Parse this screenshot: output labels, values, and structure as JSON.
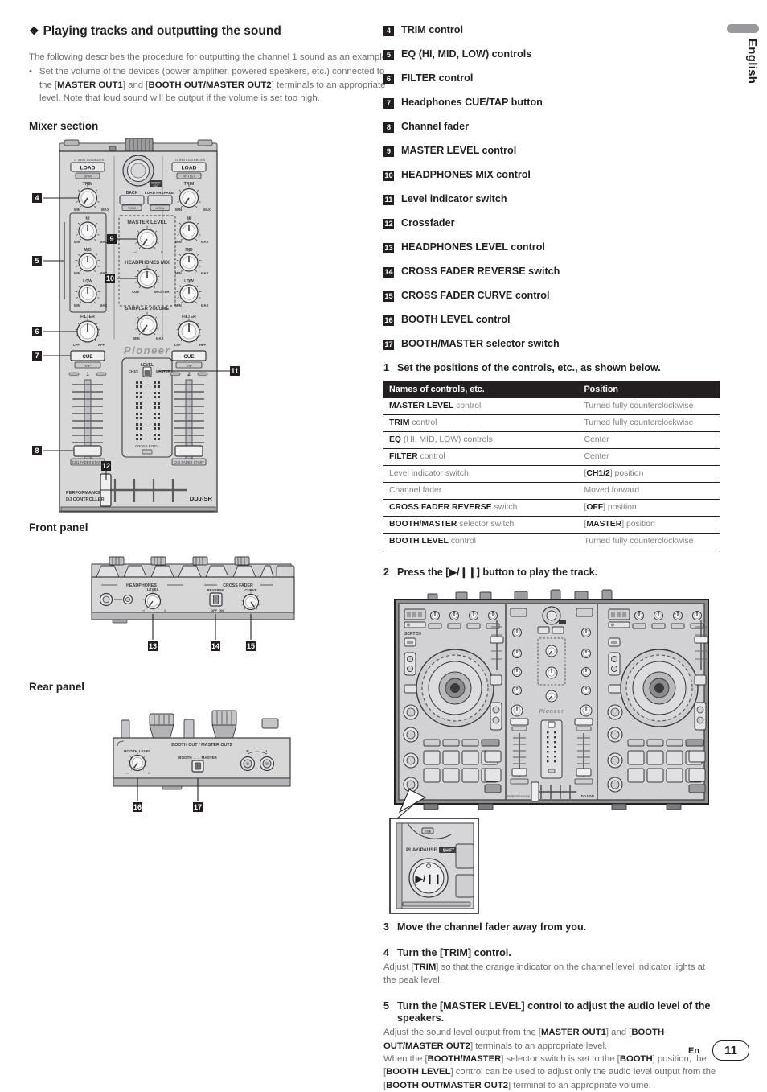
{
  "sidebar": {
    "language_tab": "English"
  },
  "left": {
    "heading": "Playing tracks and outputting the sound",
    "heading_glyph": "❖",
    "intro": "The following describes the procedure for outputting the channel 1 sound as an example.",
    "bullet_glyph": "•",
    "bullet": {
      "part1": "Set the volume of the devices (power amplifier, powered speakers, etc.) connected to the [",
      "b1": "MASTER OUT1",
      "part2": "] and [",
      "b2": "BOOTH OUT/MASTER OUT2",
      "part3": "] terminals to an appropriate level. Note that loud sound will be output if the volume is set too high."
    },
    "mixer_heading": "Mixer section",
    "front_heading": "Front panel",
    "rear_heading": "Rear panel"
  },
  "mixer_figure": {
    "labels": {
      "inst_doubles": "INST.DOUBLES",
      "load": "LOAD",
      "bpm": "BPM",
      "artist": "ARTIST",
      "trim": "TRIM",
      "min": "MIN",
      "max": "MAX",
      "hi": "HI",
      "mid": "MID",
      "low": "LOW",
      "filter": "FILTER",
      "lpf": "LPF",
      "hpf": "HPF",
      "back": "BACK",
      "view": "VIEW",
      "load_prepare": "LOAD PREPARE",
      "area": "AREA",
      "master_level": "MASTER LEVEL",
      "headphones_mix": "HEADPHONES MIX",
      "cue": "CUE",
      "master": "MASTER",
      "sampler_volume": "SAMPLER VOLUME",
      "tap": "TAP",
      "level": "LEVEL",
      "ch12": "CH1/2",
      "cross_frev": "CROSS F.REV.",
      "ch1_fader_start": "CH1 FADER START",
      "ch2_fader_start": "CH2 FADER START",
      "brand": "Pioneer",
      "performance": "PERFORMANCE",
      "dj_controller": "DJ CONTROLLER",
      "model": "DDJ-SR",
      "ch1": "1",
      "ch2": "2"
    },
    "callouts": [
      "4",
      "5",
      "6",
      "7",
      "8",
      "9",
      "10",
      "11",
      "12"
    ]
  },
  "front_figure": {
    "labels": {
      "headphones": "HEADPHONES",
      "level": "LEVEL",
      "cross_fader": "CROSS FADER",
      "reverse": "REVERSE",
      "curve": "CURVE",
      "off": "OFF",
      "on": "ON",
      "min_inf": "-∞",
      "zero": "0"
    },
    "callouts": [
      "13",
      "14",
      "15"
    ]
  },
  "rear_figure": {
    "labels": {
      "booth_out_master_out2": "BOOTH OUT / MASTER OUT2",
      "booth_level": "BOOTH LEVEL",
      "booth_master": "BOOTH ←→ MASTER",
      "r": "R",
      "l": "L"
    },
    "callouts": [
      "16",
      "17"
    ]
  },
  "controls_list": [
    {
      "num": "4",
      "label": "TRIM control"
    },
    {
      "num": "5",
      "label": "EQ (HI, MID, LOW) controls"
    },
    {
      "num": "6",
      "label": "FILTER control"
    },
    {
      "num": "7",
      "label": "Headphones CUE/TAP button"
    },
    {
      "num": "8",
      "label": "Channel fader"
    },
    {
      "num": "9",
      "label": "MASTER LEVEL control"
    },
    {
      "num": "10",
      "label": "HEADPHONES MIX control"
    },
    {
      "num": "11",
      "label": "Level indicator switch"
    },
    {
      "num": "12",
      "label": "Crossfader"
    },
    {
      "num": "13",
      "label": "HEADPHONES LEVEL control"
    },
    {
      "num": "14",
      "label": "CROSS FADER REVERSE switch"
    },
    {
      "num": "15",
      "label": "CROSS FADER CURVE control"
    },
    {
      "num": "16",
      "label": "BOOTH LEVEL control"
    },
    {
      "num": "17",
      "label": "BOOTH/MASTER selector switch"
    }
  ],
  "steps": {
    "s1": {
      "num": "1",
      "text": "Set the positions of the controls, etc., as shown below."
    },
    "s2": {
      "num": "2",
      "text": "Press the [▶/❙❙] button to play the track."
    },
    "s3": {
      "num": "3",
      "text": "Move the channel fader away from you."
    },
    "s4": {
      "num": "4",
      "text": "Turn the [TRIM] control.",
      "body_1": "Adjust [",
      "body_b1": "TRIM",
      "body_2": "] so that the orange indicator on the channel level indicator lights at the peak level."
    },
    "s5": {
      "num": "5",
      "text": "Turn the [MASTER LEVEL] control to adjust the audio level of the speakers.",
      "p1a": "Adjust the sound level output from the [",
      "p1b": "MASTER OUT1",
      "p1c": "] and [",
      "p1d": "BOOTH OUT/MASTER OUT2",
      "p1e": "] terminals to an appropriate level.",
      "p2a": "When the [",
      "p2b": "BOOTH/MASTER",
      "p2c": "] selector switch is set to the [",
      "p2d": "BOOTH",
      "p2e": "] position, the [",
      "p2f": "BOOTH LEVEL",
      "p2g": "] control can be used to adjust only the audio level output from the [",
      "p2h": "BOOTH OUT/MASTER OUT2",
      "p2i": "] terminal to an appropriate volume."
    }
  },
  "table": {
    "headers": [
      "Names of controls, etc.",
      "Position"
    ],
    "rows": [
      {
        "name_b": "MASTER LEVEL",
        "name_r": " control",
        "pos_pre": "Turned fully counterclockwise",
        "pos_b": "",
        "pos_post": ""
      },
      {
        "name_b": "TRIM",
        "name_r": " control",
        "pos_pre": "Turned fully counterclockwise",
        "pos_b": "",
        "pos_post": ""
      },
      {
        "name_b": "EQ",
        "name_r": " (HI, MID, LOW) controls",
        "pos_pre": "Center",
        "pos_b": "",
        "pos_post": ""
      },
      {
        "name_b": "FILTER",
        "name_r": " control",
        "pos_pre": "Center",
        "pos_b": "",
        "pos_post": ""
      },
      {
        "name_b": "",
        "name_r": "Level indicator switch",
        "pos_pre": "[",
        "pos_b": "CH1/2",
        "pos_post": "] position"
      },
      {
        "name_b": "",
        "name_r": "Channel fader",
        "pos_pre": "Moved forward",
        "pos_b": "",
        "pos_post": ""
      },
      {
        "name_b": "CROSS FADER REVERSE",
        "name_r": " switch",
        "pos_pre": "[",
        "pos_b": "OFF",
        "pos_post": "] position"
      },
      {
        "name_b": "BOOTH/MASTER",
        "name_r": " selector switch",
        "pos_pre": "[",
        "pos_b": "MASTER",
        "pos_post": "] position"
      },
      {
        "name_b": "BOOTH LEVEL",
        "name_r": " control",
        "pos_pre": "Turned fully counterclockwise",
        "pos_b": "",
        "pos_post": ""
      }
    ]
  },
  "controller_figure": {
    "labels": {
      "play_pause": "PLAY/PAUSE",
      "shift": "SHIFT",
      "glyph": "▶/❙❙",
      "brand": "Pioneer",
      "model": "DDJ-SR"
    }
  },
  "footer": {
    "en": "En",
    "page": "11"
  },
  "colors": {
    "ink": "#231f20",
    "body": "#6d6e70",
    "muted": "#808184",
    "tab": "#9a9a9e",
    "panel": "#d9d9d9"
  }
}
